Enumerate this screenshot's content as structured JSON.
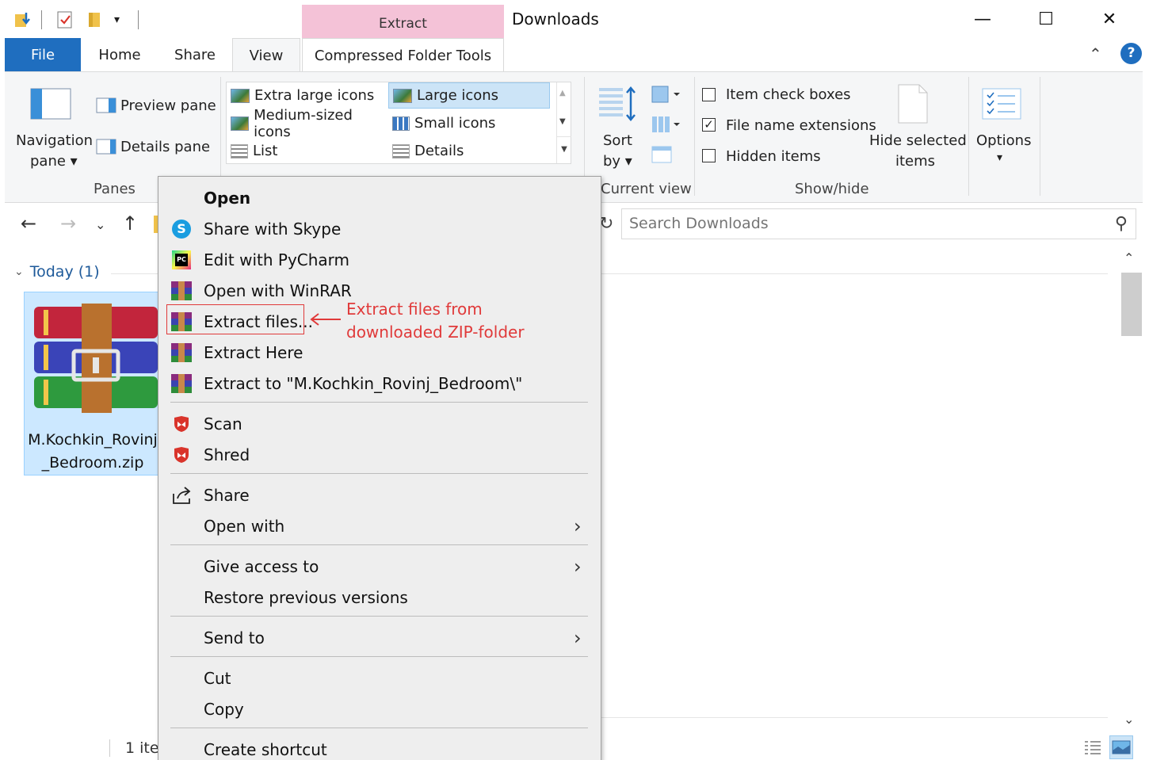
{
  "window": {
    "title": "Downloads",
    "context_tab": "Extract",
    "minimize": "—",
    "maximize": "☐",
    "close": "✕"
  },
  "tabs": {
    "file": "File",
    "home": "Home",
    "share": "Share",
    "view": "View",
    "compressed": "Compressed Folder Tools"
  },
  "ribbon": {
    "panes": {
      "navigation_pane_l1": "Navigation",
      "navigation_pane_l2": "pane",
      "preview_pane": "Preview pane",
      "details_pane": "Details pane",
      "label": "Panes"
    },
    "layout": {
      "extra_large": "Extra large icons",
      "large": "Large icons",
      "medium": "Medium-sized icons",
      "small": "Small icons",
      "list": "List",
      "details": "Details",
      "selected": "Large icons"
    },
    "current_view": {
      "sort_l1": "Sort",
      "sort_l2": "by",
      "label": "Current view"
    },
    "show_hide": {
      "item_check_boxes": "Item check boxes",
      "file_name_extensions": "File name extensions",
      "hidden_items": "Hidden items",
      "item_check_boxes_checked": false,
      "file_name_extensions_checked": true,
      "hidden_items_checked": false,
      "hide_selected_l1": "Hide selected",
      "hide_selected_l2": "items",
      "label": "Show/hide"
    },
    "options": "Options"
  },
  "address": {
    "search_placeholder": "Search Downloads"
  },
  "content": {
    "group_header": "Today (1)",
    "file_name_l1": "M.Kochkin_Rovinj",
    "file_name_l2": "_Bedroom.zip"
  },
  "status": {
    "count_text": "1 ite"
  },
  "context_menu": {
    "items": [
      {
        "label": "Open",
        "icon": "none"
      },
      {
        "label": "Share with Skype",
        "icon": "skype-icon"
      },
      {
        "label": "Edit with PyCharm",
        "icon": "pycharm-icon"
      },
      {
        "label": "Open with WinRAR",
        "icon": "winrar-icon"
      },
      {
        "label": "Extract files...",
        "icon": "winrar-icon"
      },
      {
        "label": "Extract Here",
        "icon": "winrar-icon"
      },
      {
        "label": "Extract to \"M.Kochkin_Rovinj_Bedroom\\\"",
        "icon": "winrar-icon"
      },
      {
        "label": "Scan",
        "icon": "mcafee-icon"
      },
      {
        "label": "Shred",
        "icon": "mcafee-icon"
      },
      {
        "label": "Share",
        "icon": "share-icon"
      },
      {
        "label": "Open with",
        "icon": "none"
      },
      {
        "label": "Give access to",
        "icon": "none"
      },
      {
        "label": "Restore previous versions",
        "icon": "none"
      },
      {
        "label": "Send to",
        "icon": "none"
      },
      {
        "label": "Cut",
        "icon": "none"
      },
      {
        "label": "Copy",
        "icon": "none"
      },
      {
        "label": "Create shortcut",
        "icon": "none"
      }
    ]
  },
  "annotation": {
    "line1": "Extract files from",
    "line2": "downloaded ZIP-folder"
  },
  "colors": {
    "file_tab": "#1f6ebf",
    "extract_context": "#f4c2d7",
    "selection": "#cce8ff",
    "annotation": "#e03a3a"
  }
}
